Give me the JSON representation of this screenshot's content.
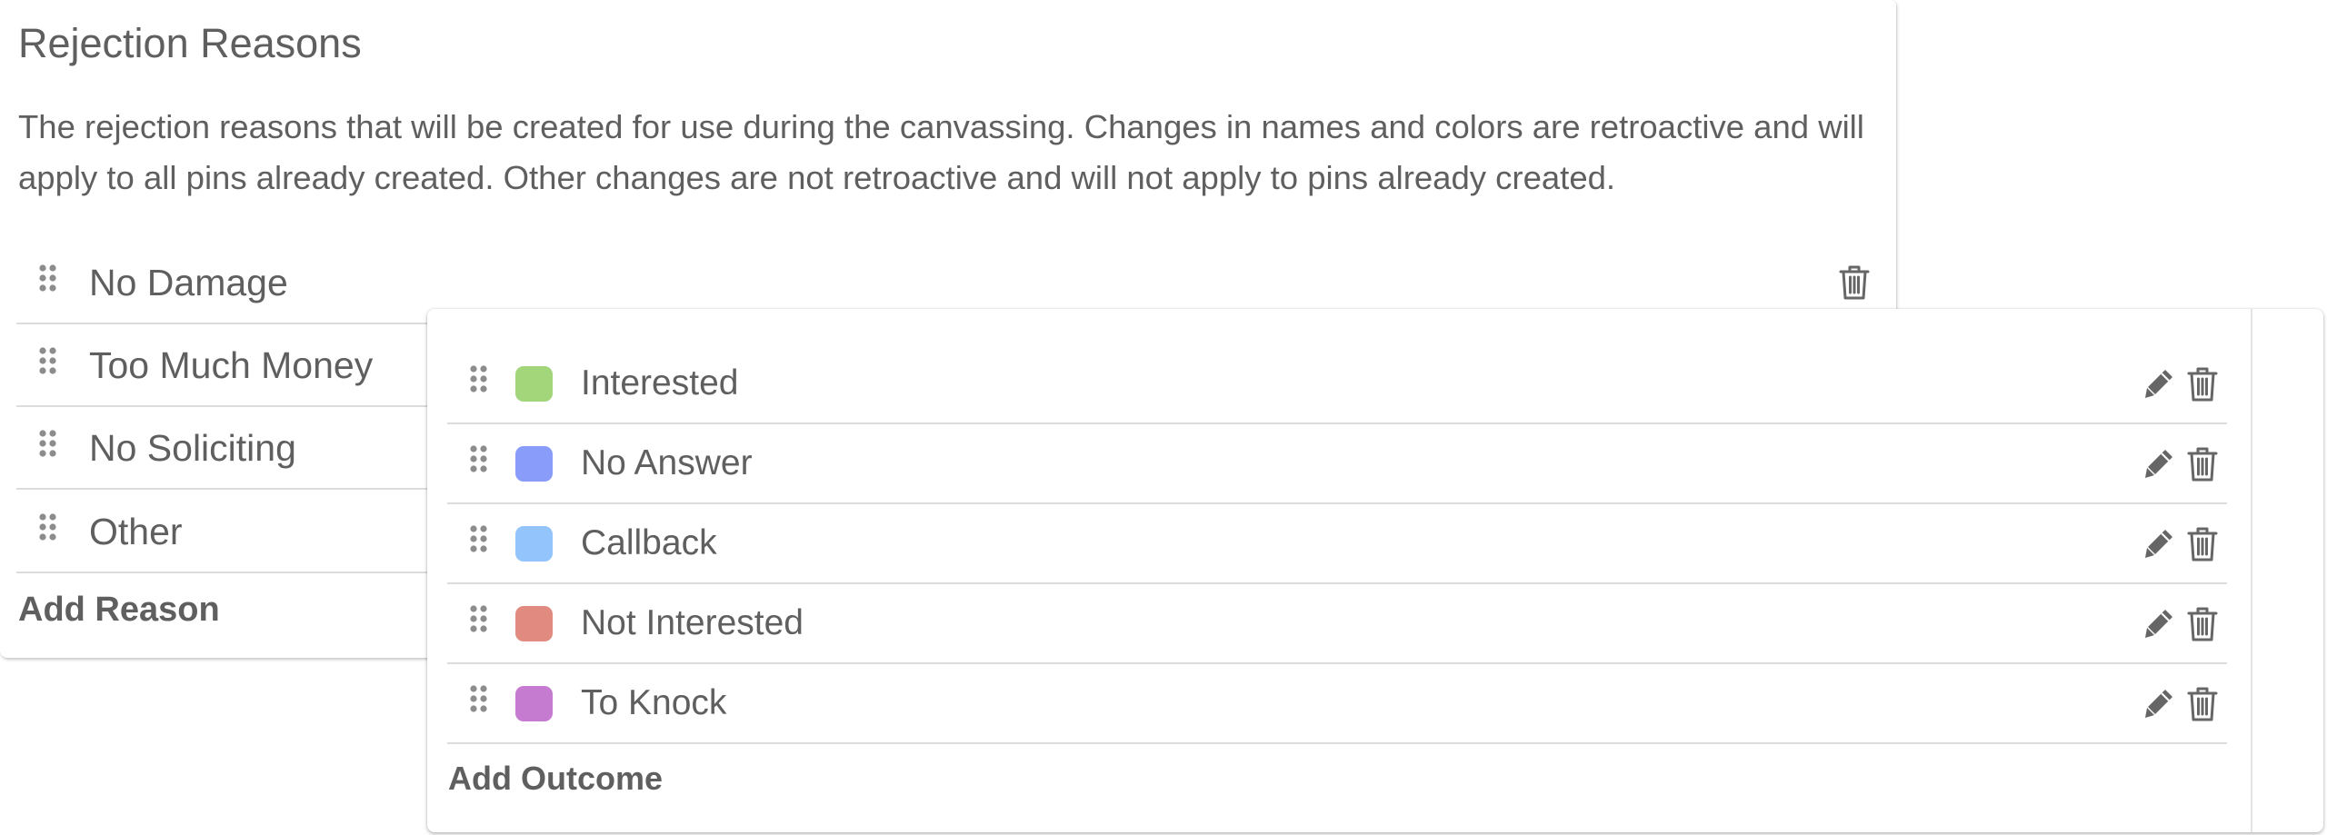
{
  "rejection_reasons": {
    "title": "Rejection Reasons",
    "description": "The rejection reasons that will be created for use during the canvassing. Changes in names and colors are retroactive and will apply to all pins already created. Other changes are not retroactive and will not apply to pins already created.",
    "items": [
      {
        "label": "No Damage",
        "icons": [
          "drag-handle-icon",
          "trash-icon"
        ]
      },
      {
        "label": "Too Much Money",
        "icons": [
          "drag-handle-icon",
          "trash-icon"
        ]
      },
      {
        "label": "No Soliciting",
        "icons": [
          "drag-handle-icon",
          "trash-icon"
        ]
      },
      {
        "label": "Other",
        "icons": [
          "drag-handle-icon",
          "trash-icon"
        ]
      }
    ],
    "add_label": "Add Reason"
  },
  "outcomes": {
    "items": [
      {
        "label": "Interested",
        "color": "#a3d67a"
      },
      {
        "label": "No Answer",
        "color": "#8a9cfa"
      },
      {
        "label": "Callback",
        "color": "#93c4fb"
      },
      {
        "label": "Not Interested",
        "color": "#e08a80"
      },
      {
        "label": "To Knock",
        "color": "#c57bcf"
      }
    ],
    "row_icons": [
      "drag-handle-icon",
      "pencil-icon",
      "trash-icon"
    ],
    "add_label": "Add Outcome"
  }
}
